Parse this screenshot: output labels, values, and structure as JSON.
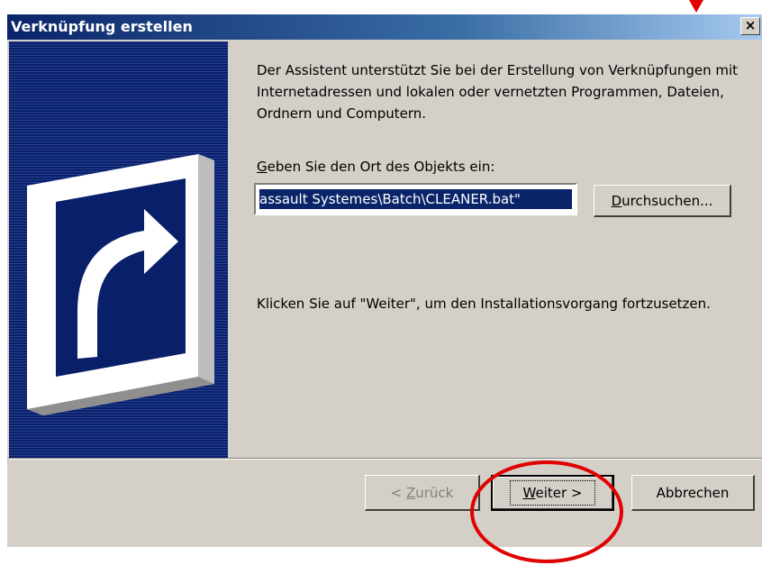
{
  "window": {
    "title": "Verknüpfung erstellen",
    "close_label": "×"
  },
  "content": {
    "intro": "Der Assistent unterstützt Sie bei der Erstellung von Verknüpfungen mit Internetadressen und lokalen oder vernetzten Programmen, Dateien, Ordnern und Computern.",
    "location_label_prefix": "G",
    "location_label_rest": "eben Sie den Ort des Objekts ein:",
    "location_value": "assault Systemes\\Batch\\CLEANER.bat\"",
    "browse_label_prefix": "D",
    "browse_label_rest": "urchsuchen...",
    "continue_text": "Klicken Sie auf \"Weiter\", um den Installationsvorgang fortzusetzen."
  },
  "footer": {
    "back_label_pre": "< ",
    "back_label_key": "Z",
    "back_label_rest": "urück",
    "next_label_key": "W",
    "next_label_rest": "eiter >",
    "cancel_label": "Abbrechen"
  },
  "colors": {
    "titlebar": "#0a246a",
    "banner": "#0a246a",
    "face": "#d4d0c8",
    "annotation": "#e00000"
  },
  "icons": {
    "banner": "shortcut-arrow-icon",
    "annotation_arrow": "red-arrow-icon"
  }
}
